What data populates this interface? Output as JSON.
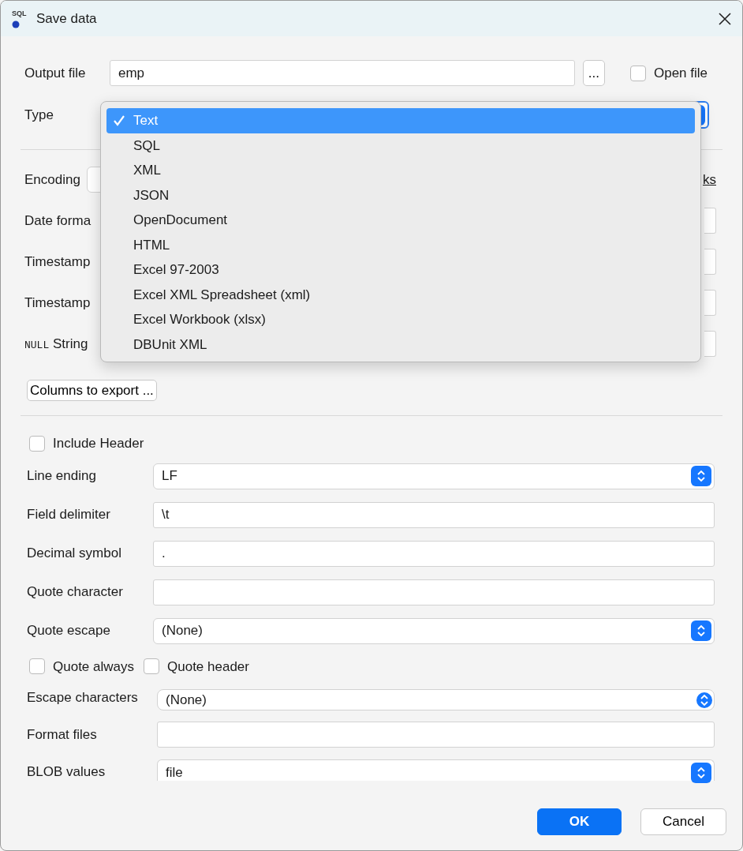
{
  "window": {
    "title": "Save data",
    "icon_text": "SQL"
  },
  "output_file": {
    "label": "Output file",
    "value": "emp",
    "browse_button": "...",
    "open_file": {
      "label": "Open file",
      "checked": false
    }
  },
  "type": {
    "label": "Type",
    "expanded": true,
    "options": [
      {
        "label": "Text",
        "selected": true
      },
      {
        "label": "SQL",
        "selected": false
      },
      {
        "label": "XML",
        "selected": false
      },
      {
        "label": "JSON",
        "selected": false
      },
      {
        "label": "OpenDocument",
        "selected": false
      },
      {
        "label": "HTML",
        "selected": false
      },
      {
        "label": "Excel 97-2003",
        "selected": false
      },
      {
        "label": "Excel XML Spreadsheet (xml)",
        "selected": false
      },
      {
        "label": "Excel Workbook (xlsx)",
        "selected": false
      },
      {
        "label": "DBUnit XML",
        "selected": false
      }
    ]
  },
  "format_rows": [
    {
      "kind": "combo",
      "label": "Encoding",
      "link": "ks"
    },
    {
      "kind": "field",
      "label": "Date forma"
    },
    {
      "kind": "field",
      "label": "Timestamp"
    },
    {
      "kind": "field",
      "label": "Timestamp"
    },
    {
      "kind": "field",
      "label_prefix": "NULL",
      "label": "String"
    }
  ],
  "columns_button": "Columns to export ...",
  "include_header": {
    "label": "Include Header",
    "checked": false
  },
  "export_rows": [
    {
      "kind": "select",
      "label": "Line ending",
      "value": "LF"
    },
    {
      "kind": "input",
      "label": "Field delimiter",
      "value": "\\t"
    },
    {
      "kind": "input",
      "label": "Decimal symbol",
      "value": "."
    },
    {
      "kind": "input",
      "label": "Quote character"
    },
    {
      "kind": "select",
      "label": "Quote escape",
      "value": "(None)"
    }
  ],
  "quote_checks": [
    {
      "label": "Quote always",
      "checked": false
    },
    {
      "label": "Quote header",
      "checked": false
    }
  ],
  "more_rows": [
    {
      "kind": "select",
      "label": "Escape characters",
      "value": "(None)"
    },
    {
      "kind": "input",
      "label": "Format files"
    },
    {
      "kind": "select",
      "label": "BLOB values",
      "value": "file"
    }
  ],
  "buttons": [
    {
      "label": "OK",
      "primary": true
    },
    {
      "label": "Cancel",
      "primary": false
    }
  ]
}
